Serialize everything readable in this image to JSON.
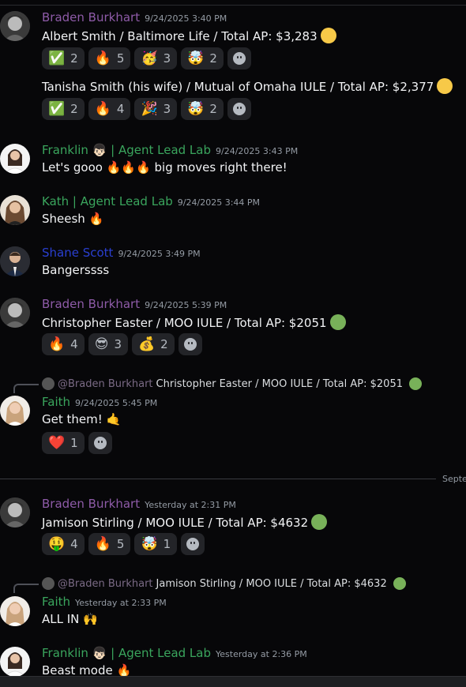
{
  "colors": {
    "braden": "#8e5ba8",
    "franklin": "#3aa55d",
    "kath": "#3aa55d",
    "shane": "#2a3fd1",
    "faith": "#3aa55d"
  },
  "messages": [
    {
      "author": "Braden Burkhart",
      "time": "9/24/2025 3:40 PM",
      "text": "Albert Smith / Baltimore Life / Total AP: $3,283",
      "reactions": [
        {
          "emoji": "✅",
          "count": "2"
        },
        {
          "emoji": "🔥",
          "count": "5"
        },
        {
          "emoji": "🥳",
          "count": "3"
        },
        {
          "emoji": "🤯",
          "count": "2"
        }
      ],
      "text2": "Tanisha Smith (his wife) / Mutual of Omaha IULE / Total AP: $2,377",
      "reactions2": [
        {
          "emoji": "✅",
          "count": "2"
        },
        {
          "emoji": "🔥",
          "count": "4"
        },
        {
          "emoji": "🎉",
          "count": "3"
        },
        {
          "emoji": "🤯",
          "count": "2"
        }
      ]
    },
    {
      "author": "Franklin 👦🏻 | Agent Lead Lab",
      "time": "9/24/2025 3:43 PM",
      "text": "Let's gooo 🔥🔥🔥 big moves right there!"
    },
    {
      "author": "Kath | Agent Lead Lab",
      "time": "9/24/2025 3:44 PM",
      "text": "Sheesh 🔥"
    },
    {
      "author": "Shane Scott",
      "time": "9/24/2025 3:49 PM",
      "text": "Bangerssss"
    },
    {
      "author": "Braden Burkhart",
      "time": "9/24/2025 5:39 PM",
      "text": "Christopher Easter / MOO IULE / Total AP: $2051",
      "reactions": [
        {
          "emoji": "🔥",
          "count": "4"
        },
        {
          "emoji": "😎",
          "count": "3"
        },
        {
          "emoji": "💰",
          "count": "2"
        }
      ]
    },
    {
      "reply_name": "@Braden Burkhart",
      "reply_text": "Christopher Easter / MOO IULE / Total AP: $2051",
      "author": "Faith",
      "time": "9/24/2025 5:45 PM",
      "text": "Get them! 🤙",
      "reactions": [
        {
          "emoji": "❤️",
          "count": "1"
        }
      ]
    },
    {
      "author": "Braden Burkhart",
      "time": "Yesterday at 2:31 PM",
      "text": "Jamison Stirling / MOO IULE / Total AP: $4632",
      "reactions": [
        {
          "emoji": "🤑",
          "count": "4"
        },
        {
          "emoji": "🔥",
          "count": "5"
        },
        {
          "emoji": "🤯",
          "count": "1"
        }
      ]
    },
    {
      "reply_name": "@Braden Burkhart",
      "reply_text": "Jamison Stirling / MOO IULE / Total AP: $4632",
      "author": "Faith",
      "time": "Yesterday at 2:33 PM",
      "text": "ALL IN 🙌"
    },
    {
      "author": "Franklin 👦🏻 | Agent Lead Lab",
      "time": "Yesterday at 2:36 PM",
      "text": "Beast mode 🔥"
    }
  ],
  "divider_label": "Septe"
}
